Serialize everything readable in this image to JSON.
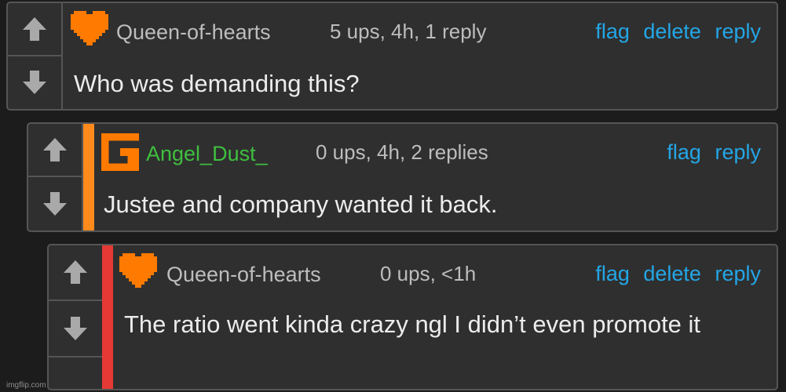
{
  "comments": [
    {
      "username": "Queen-of-hearts",
      "meta": "5 ups, 4h, 1 reply",
      "actions": [
        "flag",
        "delete",
        "reply"
      ],
      "text": "Who was demanding this?",
      "username_color": "#bdbdbd",
      "badge": "orange-heart-icon"
    },
    {
      "username": "Angel_Dust_",
      "meta": "0 ups, 4h, 2 replies",
      "actions": [
        "flag",
        "reply"
      ],
      "text": "Justee and company wanted it back.",
      "username_color": "#3fbf3f",
      "bar_color": "#ff8a1c",
      "badge": "orange-g-icon"
    },
    {
      "username": "Queen-of-hearts",
      "meta": "0 ups, <1h",
      "actions": [
        "flag",
        "delete",
        "reply"
      ],
      "text": "The ratio went kinda crazy ngl I didn’t even promote it",
      "username_color": "#bdbdbd",
      "bar_color": "#e53935",
      "badge": "orange-heart-icon"
    }
  ],
  "colors": {
    "background": "#1c1c1c",
    "panel": "#2f2f2f",
    "border": "#555555",
    "link": "#23a6e6",
    "badge_orange": "#ff7a00"
  },
  "watermark": "imgflip.com"
}
